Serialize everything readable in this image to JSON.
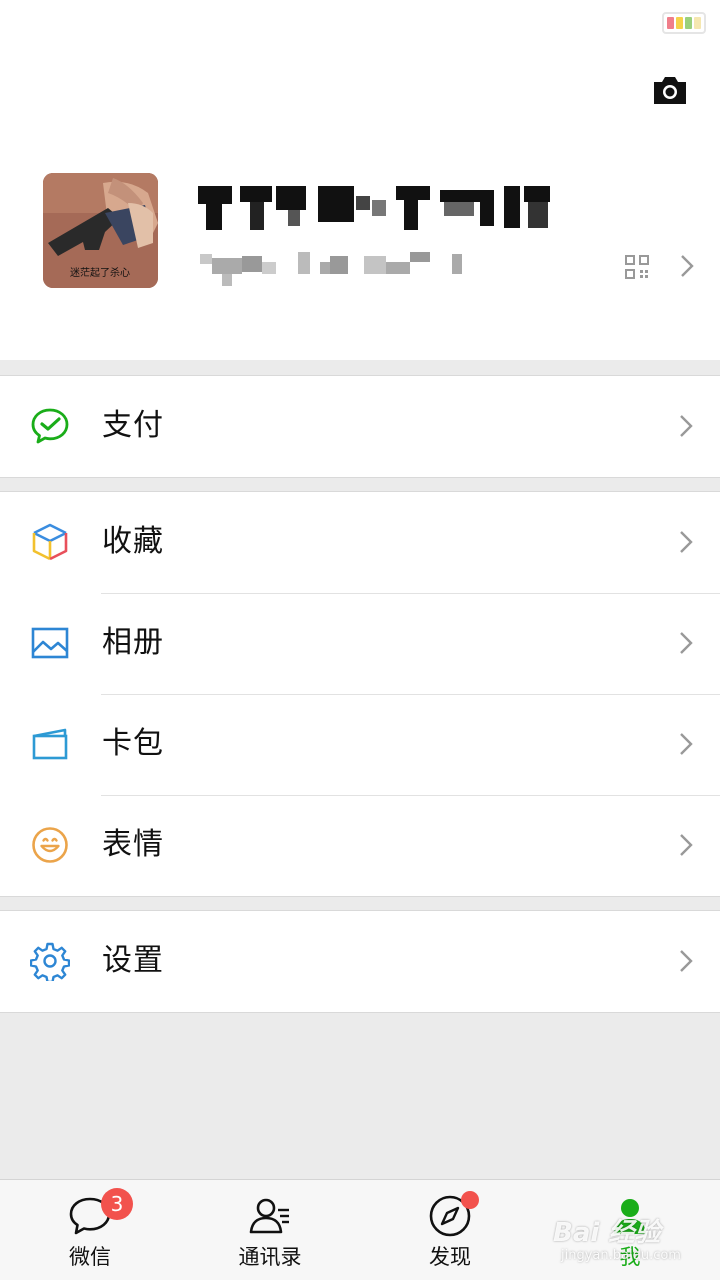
{
  "profile": {
    "avatar_caption": "迷茫起了杀心"
  },
  "menu": {
    "pay": {
      "label": "支付",
      "icon": "wechat-pay-icon"
    },
    "favorites": {
      "label": "收藏",
      "icon": "favorites-cube-icon"
    },
    "album": {
      "label": "相册",
      "icon": "album-image-icon"
    },
    "cards": {
      "label": "卡包",
      "icon": "card-wallet-icon"
    },
    "stickers": {
      "label": "表情",
      "icon": "smiley-icon"
    },
    "settings": {
      "label": "设置",
      "icon": "gear-icon"
    }
  },
  "tabbar": {
    "chats": {
      "label": "微信",
      "badge": "3",
      "icon": "chat-bubble-icon"
    },
    "contacts": {
      "label": "通讯录",
      "icon": "contacts-icon"
    },
    "discover": {
      "label": "发现",
      "icon": "compass-icon"
    },
    "me": {
      "label": "我",
      "icon": "person-icon"
    }
  },
  "watermark": {
    "line1": "Bai 经验",
    "line2": "jingyan.baidu.com"
  },
  "colors": {
    "accent_green": "#1aad19",
    "badge_red": "#f2524d",
    "background": "#ebebeb"
  }
}
